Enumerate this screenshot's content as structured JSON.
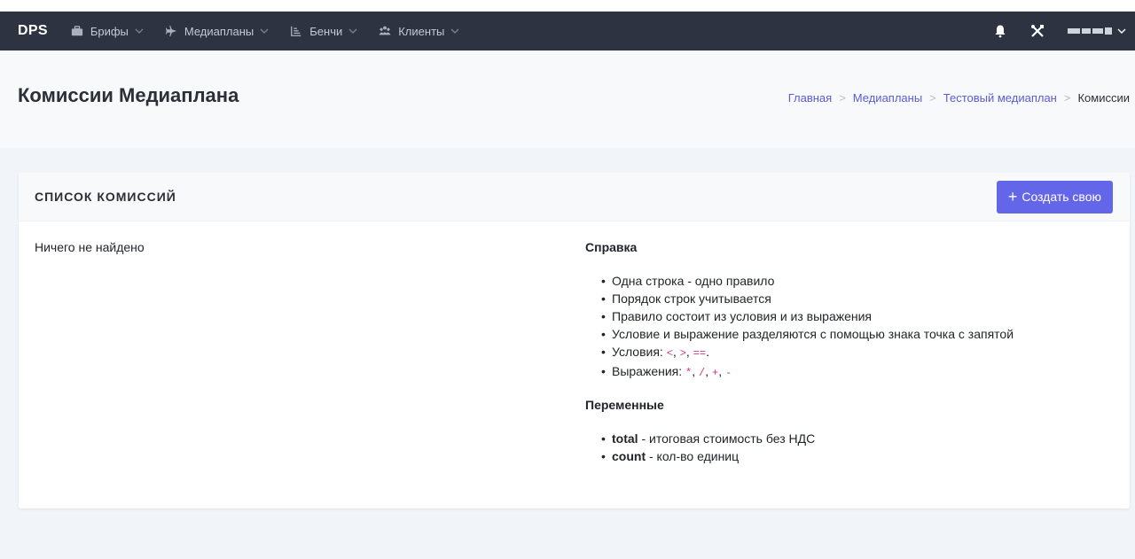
{
  "navbar": {
    "brand": "DPS",
    "items": [
      {
        "label": "Брифы",
        "icon": "briefcase-icon"
      },
      {
        "label": "Медиапланы",
        "icon": "plane-icon"
      },
      {
        "label": "Бенчи",
        "icon": "chart-icon"
      },
      {
        "label": "Клиенты",
        "icon": "users-icon"
      }
    ],
    "right_icons": [
      "bell-icon",
      "tools-icon"
    ]
  },
  "page": {
    "title": "Комиссии Медиаплана",
    "breadcrumb": [
      "Главная",
      "Медиапланы",
      "Тестовый медиаплан",
      "Комиссии"
    ]
  },
  "card": {
    "title": "список комиссий",
    "create_button": "+ Создать свою",
    "create_button_text": "Создать свою",
    "empty_text": "Ничего не найдено"
  },
  "help": {
    "title": "Справка",
    "rules": [
      "Одна строка - одно правило",
      "Порядок строк учитывается",
      "Правило состоит из условия и из выражения",
      "Условие и выражение разделяются с помощью знака точка с запятой"
    ],
    "conditions_label": "Условия:",
    "conditions": [
      "<",
      ">",
      "=="
    ],
    "expressions_label": "Выражения:",
    "expressions": [
      "*",
      "/",
      "+",
      "-"
    ],
    "variables_title": "Переменные",
    "variables": [
      {
        "name": "total",
        "desc": " - итоговая стоимость без НДС"
      },
      {
        "name": "count",
        "desc": " - кол-во единиц"
      }
    ]
  },
  "colors": {
    "navbar_bg": "#2d3340",
    "accent": "#6466e9",
    "link": "#5a5cd6",
    "code": "#d63384"
  }
}
